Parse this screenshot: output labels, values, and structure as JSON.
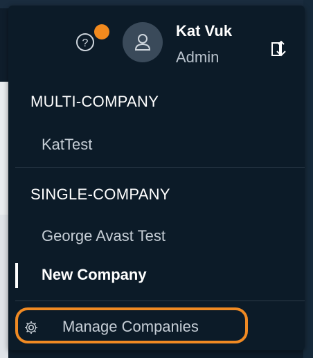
{
  "user": {
    "name": "Kat Vuk",
    "role": "Admin"
  },
  "icons": {
    "help": "help-circle-icon",
    "avatar": "user-avatar-icon",
    "switch": "switch-company-icon",
    "settings": "gear-icon",
    "notification_color": "#f28a1e"
  },
  "menu": {
    "multi_company_title": "MULTI-COMPANY",
    "multi_company_items": [
      "KatTest"
    ],
    "single_company_title": "SINGLE-COMPANY",
    "single_company_items": [
      "George Avast Test",
      "New Company"
    ],
    "active_item": "New Company",
    "manage_label": "Manage Companies",
    "highlight_color": "#f08a23"
  }
}
